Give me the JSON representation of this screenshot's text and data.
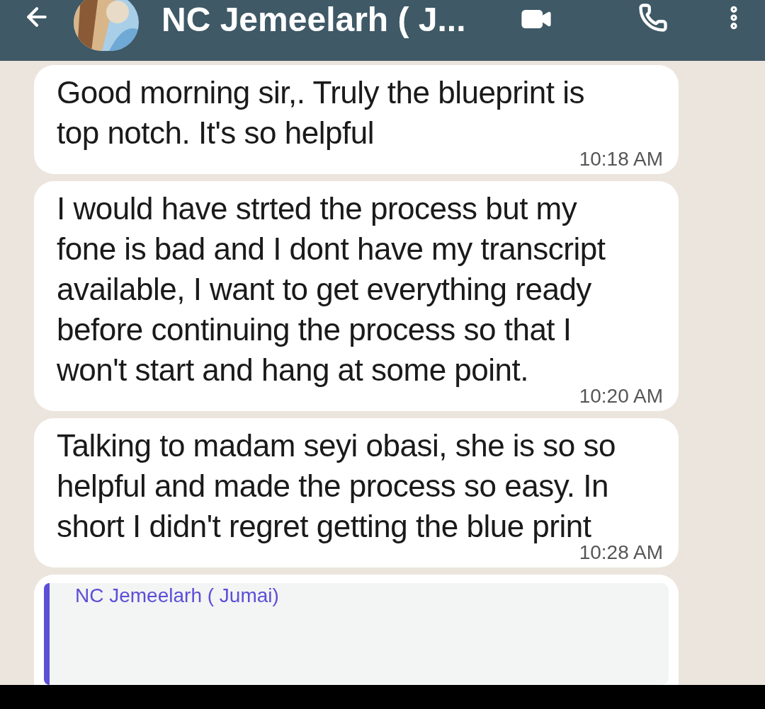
{
  "header": {
    "title": "NC Jemeelarh ( J..."
  },
  "messages": [
    {
      "text": "Good morning sir,. Truly the blueprint is top notch. It's so helpful",
      "time": "10:18 AM"
    },
    {
      "text": "I would have strted the process but my fone is bad and I dont have my transcript available, I want to get everything ready before continuing the process so that I won't start and hang at some point.",
      "time": "10:20 AM"
    },
    {
      "text": "Talking to madam seyi obasi, she is so so helpful and made the process so easy. In short I didn't regret getting the blue print",
      "time": "10:28 AM"
    }
  ],
  "quoted_message": {
    "sender": "NC Jemeelarh ( Jumai)",
    "color": "#5b4fd6"
  }
}
